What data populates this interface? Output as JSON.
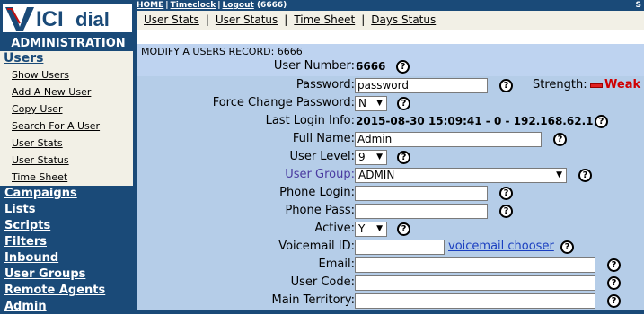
{
  "logo": {
    "text": "VICIdial"
  },
  "sidebar": {
    "header": "ADMINISTRATION",
    "section_title": "Users",
    "sub_items": [
      "Show Users",
      "Add A New User",
      "Copy User",
      "Search For A User",
      "User Stats",
      "User Status",
      "Time Sheet"
    ],
    "nav_items": [
      "Campaigns",
      "Lists",
      "Scripts",
      "Filters",
      "Inbound",
      "User Groups",
      "Remote Agents",
      "Admin"
    ]
  },
  "topbar": {
    "home": "HOME",
    "timeclock": "Timeclock",
    "logout": "Logout",
    "user": "(6666)",
    "right_text": "S"
  },
  "subnav": {
    "items": [
      "User Stats",
      "User Status",
      "Time Sheet",
      "Days Status"
    ]
  },
  "page": {
    "title": "MODIFY A USERS RECORD: 6666"
  },
  "form": {
    "user_number_label": "User Number:",
    "user_number": "6666",
    "password_label": "Password:",
    "password": "password",
    "strength_label": "Strength:",
    "strength_value": "Weak",
    "force_change_label": "Force Change Password:",
    "force_change": "N",
    "last_login_label": "Last Login Info:",
    "last_login": "2015-08-30 15:09:41 - 0 - 192.168.62.1",
    "full_name_label": "Full Name:",
    "full_name": "Admin",
    "user_level_label": "User Level:",
    "user_level": "9",
    "user_group_label": "User Group:",
    "user_group": "ADMIN",
    "phone_login_label": "Phone Login:",
    "phone_login": "",
    "phone_pass_label": "Phone Pass:",
    "phone_pass": "",
    "active_label": "Active:",
    "active": "Y",
    "voicemail_label": "Voicemail ID:",
    "voicemail": "",
    "voicemail_chooser": "voicemail chooser",
    "email_label": "Email:",
    "email": "",
    "user_code_label": "User Code:",
    "user_code": "",
    "territory_label": "Main Territory:",
    "territory": "",
    "help_glyph": "?"
  },
  "colors": {
    "nav_bg": "#1a4a78",
    "form_bg": "#b5cde8",
    "strength_weak": "#d00000"
  }
}
